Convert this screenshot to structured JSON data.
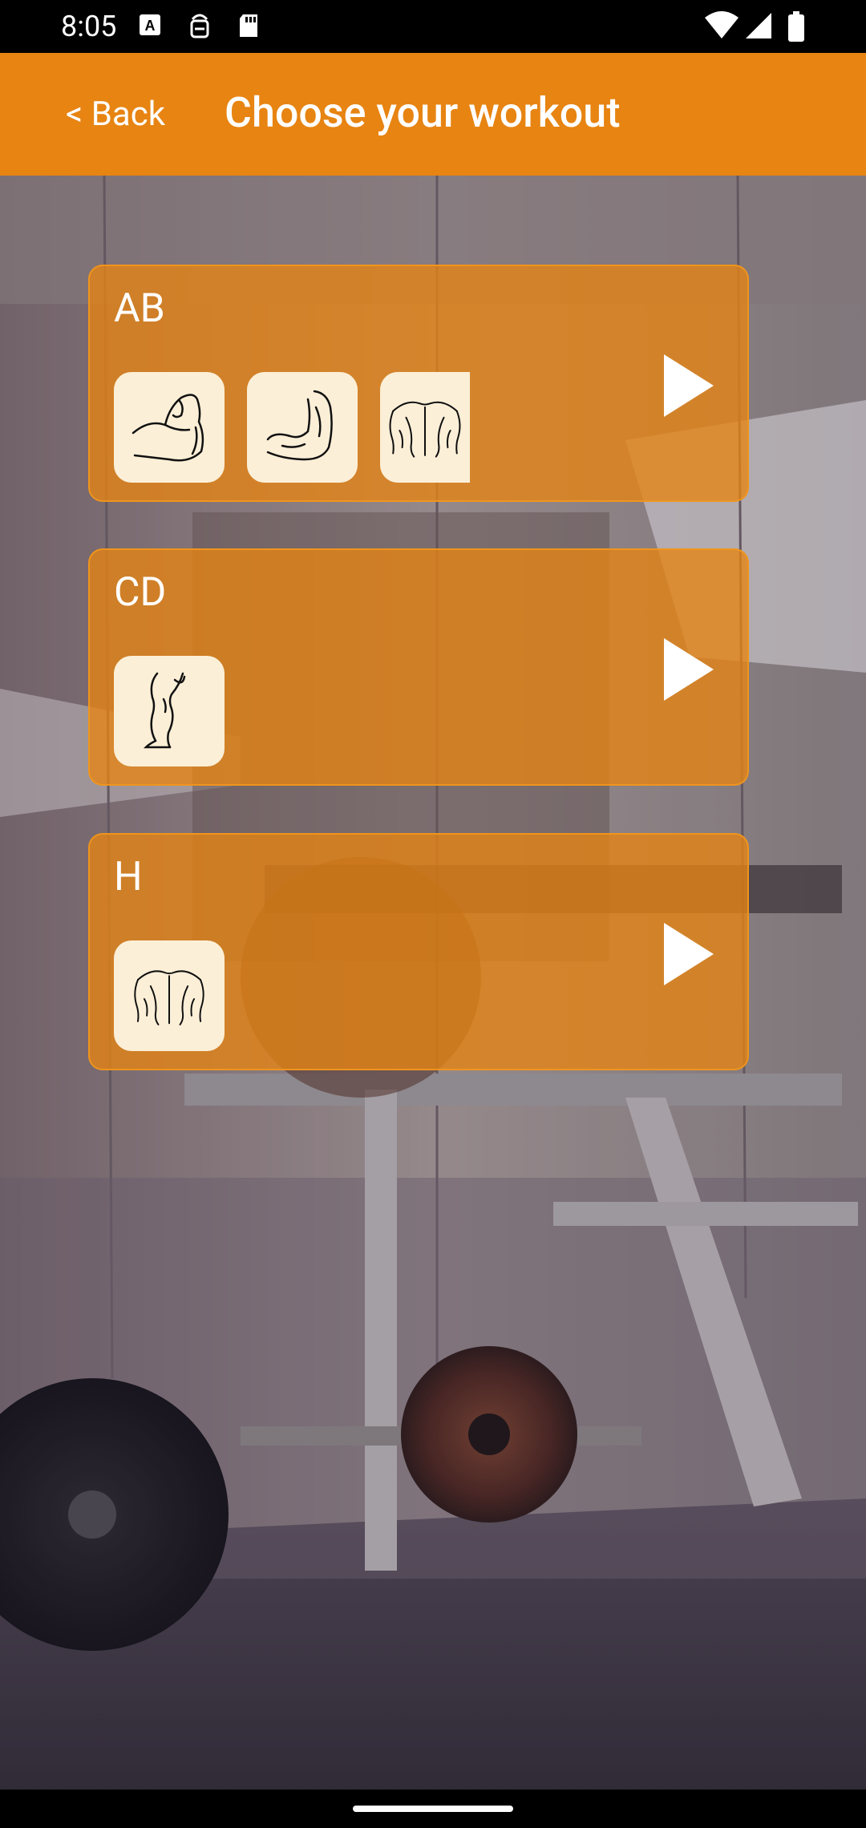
{
  "status_bar": {
    "time": "8:05",
    "left_icons": [
      "a-icon",
      "sim-icon",
      "sd-card-icon"
    ],
    "right_icons": [
      "wifi-icon",
      "signal-icon",
      "battery-icon"
    ]
  },
  "header": {
    "back_label": "< Back",
    "title": "Choose your workout",
    "color": "#E78412"
  },
  "workouts": [
    {
      "name": "AB",
      "muscles": [
        "biceps-icon",
        "forearm-arm-icon",
        "back-icon"
      ]
    },
    {
      "name": "CD",
      "muscles": [
        "leg-icon"
      ]
    },
    {
      "name": "H",
      "muscles": [
        "back-icon"
      ]
    }
  ]
}
